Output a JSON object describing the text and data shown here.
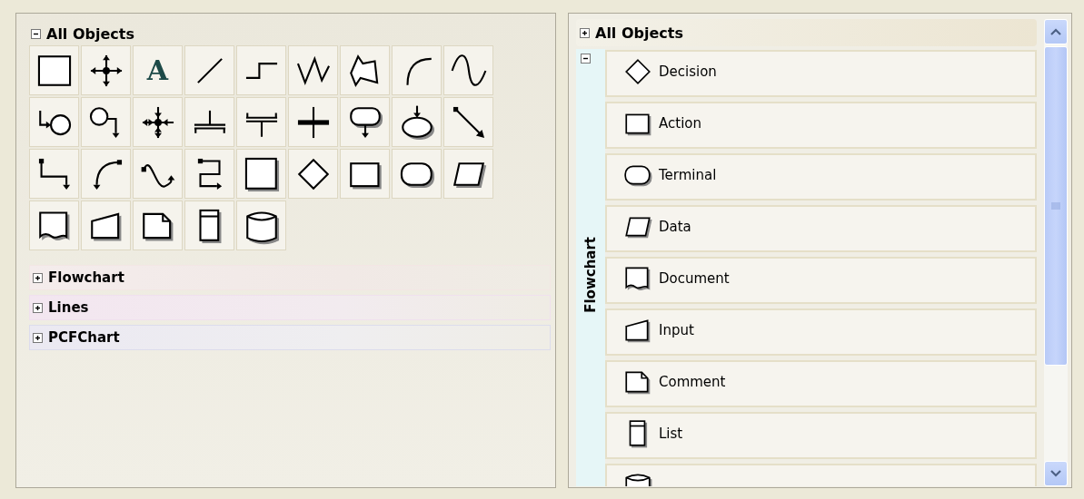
{
  "left_panel": {
    "title": "All Objects",
    "expanded": true,
    "palette": [
      {
        "kind": "rectangle"
      },
      {
        "kind": "move"
      },
      {
        "kind": "text",
        "glyph": "A"
      },
      {
        "kind": "line"
      },
      {
        "kind": "step"
      },
      {
        "kind": "zigzag"
      },
      {
        "kind": "polygon"
      },
      {
        "kind": "arc"
      },
      {
        "kind": "wave"
      },
      {
        "kind": "arrow_circle"
      },
      {
        "kind": "circle_arrow"
      },
      {
        "kind": "move_in"
      },
      {
        "kind": "tee_up"
      },
      {
        "kind": "tee_down"
      },
      {
        "kind": "bold_cross"
      },
      {
        "kind": "callout"
      },
      {
        "kind": "ellipse_in"
      },
      {
        "kind": "diagonal"
      },
      {
        "kind": "elbow"
      },
      {
        "kind": "curve"
      },
      {
        "kind": "s_curve"
      },
      {
        "kind": "loop"
      },
      {
        "kind": "process"
      },
      {
        "kind": "decision"
      },
      {
        "kind": "action"
      },
      {
        "kind": "terminal"
      },
      {
        "kind": "data"
      },
      {
        "kind": "document"
      },
      {
        "kind": "input"
      },
      {
        "kind": "comment"
      },
      {
        "kind": "list"
      },
      {
        "kind": "database"
      }
    ],
    "sections": [
      {
        "label": "Flowchart",
        "expanded": false
      },
      {
        "label": "Lines",
        "expanded": false
      },
      {
        "label": "PCFChart",
        "expanded": false
      }
    ]
  },
  "right_panel": {
    "header": {
      "title": "All Objects",
      "expanded": false
    },
    "group": {
      "label": "Flowchart",
      "expanded": true,
      "items": [
        {
          "kind": "decision",
          "label": "Decision"
        },
        {
          "kind": "action",
          "label": "Action"
        },
        {
          "kind": "terminal",
          "label": "Terminal"
        },
        {
          "kind": "data",
          "label": "Data"
        },
        {
          "kind": "document",
          "label": "Document"
        },
        {
          "kind": "input",
          "label": "Input"
        },
        {
          "kind": "comment",
          "label": "Comment"
        },
        {
          "kind": "list",
          "label": "List"
        },
        {
          "kind": "database"
        }
      ]
    }
  }
}
